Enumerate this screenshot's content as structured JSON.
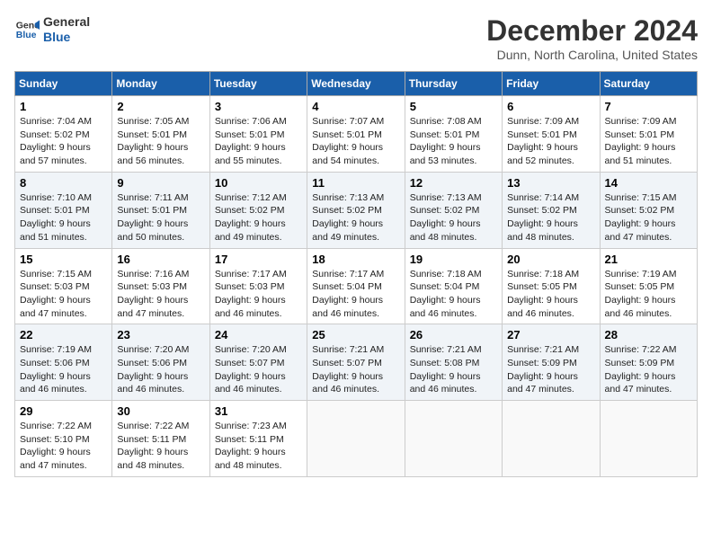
{
  "header": {
    "logo_line1": "General",
    "logo_line2": "Blue",
    "month": "December 2024",
    "location": "Dunn, North Carolina, United States"
  },
  "weekdays": [
    "Sunday",
    "Monday",
    "Tuesday",
    "Wednesday",
    "Thursday",
    "Friday",
    "Saturday"
  ],
  "weeks": [
    [
      {
        "day": 1,
        "sunrise": "7:04 AM",
        "sunset": "5:02 PM",
        "daylight": "9 hours and 57 minutes."
      },
      {
        "day": 2,
        "sunrise": "7:05 AM",
        "sunset": "5:01 PM",
        "daylight": "9 hours and 56 minutes."
      },
      {
        "day": 3,
        "sunrise": "7:06 AM",
        "sunset": "5:01 PM",
        "daylight": "9 hours and 55 minutes."
      },
      {
        "day": 4,
        "sunrise": "7:07 AM",
        "sunset": "5:01 PM",
        "daylight": "9 hours and 54 minutes."
      },
      {
        "day": 5,
        "sunrise": "7:08 AM",
        "sunset": "5:01 PM",
        "daylight": "9 hours and 53 minutes."
      },
      {
        "day": 6,
        "sunrise": "7:09 AM",
        "sunset": "5:01 PM",
        "daylight": "9 hours and 52 minutes."
      },
      {
        "day": 7,
        "sunrise": "7:09 AM",
        "sunset": "5:01 PM",
        "daylight": "9 hours and 51 minutes."
      }
    ],
    [
      {
        "day": 8,
        "sunrise": "7:10 AM",
        "sunset": "5:01 PM",
        "daylight": "9 hours and 51 minutes."
      },
      {
        "day": 9,
        "sunrise": "7:11 AM",
        "sunset": "5:01 PM",
        "daylight": "9 hours and 50 minutes."
      },
      {
        "day": 10,
        "sunrise": "7:12 AM",
        "sunset": "5:02 PM",
        "daylight": "9 hours and 49 minutes."
      },
      {
        "day": 11,
        "sunrise": "7:13 AM",
        "sunset": "5:02 PM",
        "daylight": "9 hours and 49 minutes."
      },
      {
        "day": 12,
        "sunrise": "7:13 AM",
        "sunset": "5:02 PM",
        "daylight": "9 hours and 48 minutes."
      },
      {
        "day": 13,
        "sunrise": "7:14 AM",
        "sunset": "5:02 PM",
        "daylight": "9 hours and 48 minutes."
      },
      {
        "day": 14,
        "sunrise": "7:15 AM",
        "sunset": "5:02 PM",
        "daylight": "9 hours and 47 minutes."
      }
    ],
    [
      {
        "day": 15,
        "sunrise": "7:15 AM",
        "sunset": "5:03 PM",
        "daylight": "9 hours and 47 minutes."
      },
      {
        "day": 16,
        "sunrise": "7:16 AM",
        "sunset": "5:03 PM",
        "daylight": "9 hours and 47 minutes."
      },
      {
        "day": 17,
        "sunrise": "7:17 AM",
        "sunset": "5:03 PM",
        "daylight": "9 hours and 46 minutes."
      },
      {
        "day": 18,
        "sunrise": "7:17 AM",
        "sunset": "5:04 PM",
        "daylight": "9 hours and 46 minutes."
      },
      {
        "day": 19,
        "sunrise": "7:18 AM",
        "sunset": "5:04 PM",
        "daylight": "9 hours and 46 minutes."
      },
      {
        "day": 20,
        "sunrise": "7:18 AM",
        "sunset": "5:05 PM",
        "daylight": "9 hours and 46 minutes."
      },
      {
        "day": 21,
        "sunrise": "7:19 AM",
        "sunset": "5:05 PM",
        "daylight": "9 hours and 46 minutes."
      }
    ],
    [
      {
        "day": 22,
        "sunrise": "7:19 AM",
        "sunset": "5:06 PM",
        "daylight": "9 hours and 46 minutes."
      },
      {
        "day": 23,
        "sunrise": "7:20 AM",
        "sunset": "5:06 PM",
        "daylight": "9 hours and 46 minutes."
      },
      {
        "day": 24,
        "sunrise": "7:20 AM",
        "sunset": "5:07 PM",
        "daylight": "9 hours and 46 minutes."
      },
      {
        "day": 25,
        "sunrise": "7:21 AM",
        "sunset": "5:07 PM",
        "daylight": "9 hours and 46 minutes."
      },
      {
        "day": 26,
        "sunrise": "7:21 AM",
        "sunset": "5:08 PM",
        "daylight": "9 hours and 46 minutes."
      },
      {
        "day": 27,
        "sunrise": "7:21 AM",
        "sunset": "5:09 PM",
        "daylight": "9 hours and 47 minutes."
      },
      {
        "day": 28,
        "sunrise": "7:22 AM",
        "sunset": "5:09 PM",
        "daylight": "9 hours and 47 minutes."
      }
    ],
    [
      {
        "day": 29,
        "sunrise": "7:22 AM",
        "sunset": "5:10 PM",
        "daylight": "9 hours and 47 minutes."
      },
      {
        "day": 30,
        "sunrise": "7:22 AM",
        "sunset": "5:11 PM",
        "daylight": "9 hours and 48 minutes."
      },
      {
        "day": 31,
        "sunrise": "7:23 AM",
        "sunset": "5:11 PM",
        "daylight": "9 hours and 48 minutes."
      },
      null,
      null,
      null,
      null
    ]
  ]
}
